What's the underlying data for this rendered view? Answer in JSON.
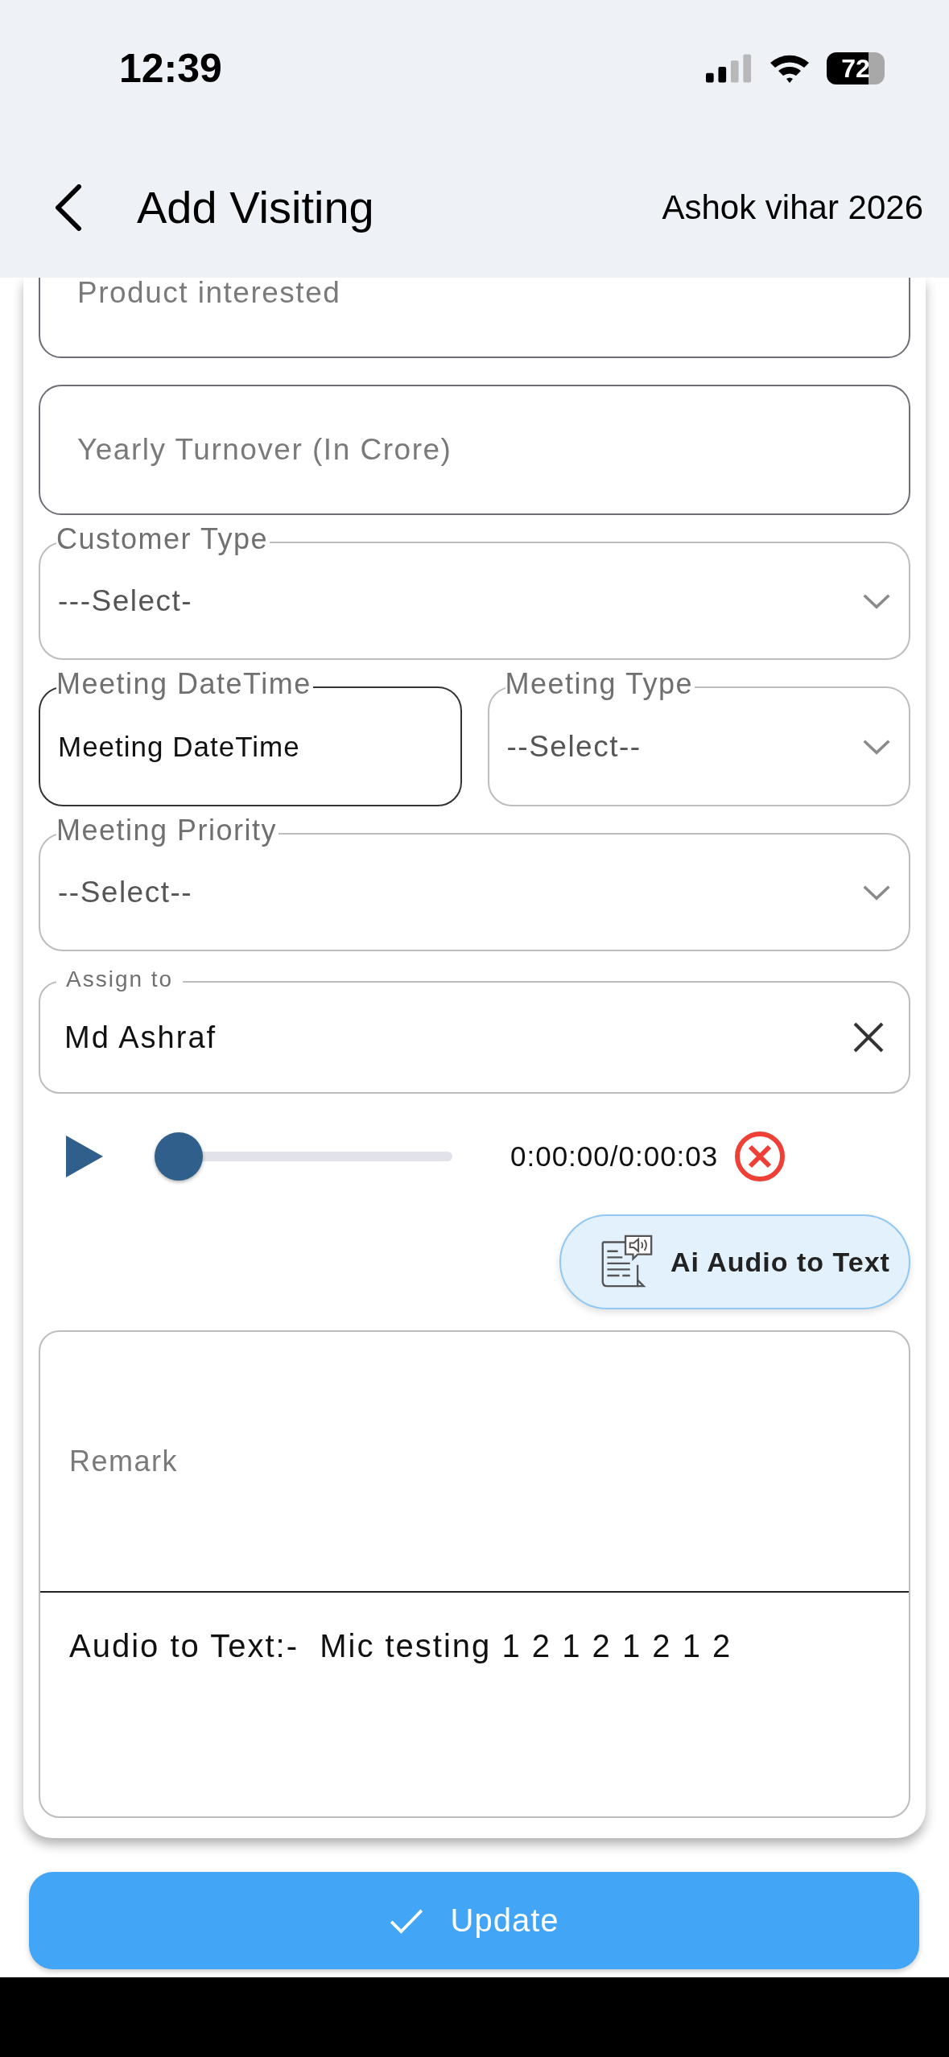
{
  "status_bar": {
    "time": "12:39",
    "battery": "72"
  },
  "header": {
    "title": "Add Visiting",
    "location": "Ashok vihar 2026"
  },
  "fields": [
    {
      "kind": "text",
      "placeholder": "Product interested"
    },
    {
      "kind": "text",
      "placeholder": "Yearly Turnover (In Crore)"
    },
    {
      "kind": "select",
      "label": "Customer Type",
      "value": "---Select-"
    }
  ],
  "meeting": [
    {
      "kind": "datetime",
      "label": "Meeting DateTime",
      "value": "Meeting DateTime"
    },
    {
      "kind": "select",
      "label": "Meeting Type",
      "value": "--Select--"
    }
  ],
  "priority": {
    "kind": "select",
    "label": "Meeting Priority",
    "value": "--Select--"
  },
  "assign": {
    "label": "Assign to",
    "value": "Md Ashraf"
  },
  "audio": {
    "level": 0,
    "time": "0:00:00/0:00:03"
  },
  "ai_button": {
    "label": "Ai Audio to Text"
  },
  "remark": {
    "placeholder": "Remark",
    "transcript": "Audio to Text:-  Mic testing 1 2 1 2 1 2 1 2"
  },
  "update_button": {
    "label": "Update"
  }
}
